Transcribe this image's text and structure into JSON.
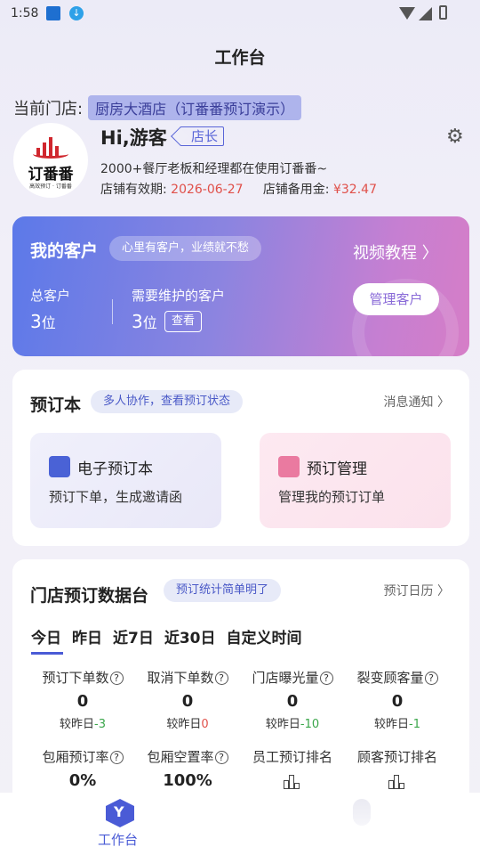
{
  "status_bar": {
    "time": "1:58"
  },
  "header": {
    "title": "工作台"
  },
  "store": {
    "label": "当前门店:",
    "name": "厨房大酒店（订番番预订演示）"
  },
  "profile": {
    "logo_brand": "订番番",
    "logo_sub": "高效预订 · 订番番",
    "greeting": "Hi,游客",
    "role": "店长",
    "description": "2000+餐厅老板和经理都在使用订番番~",
    "validity_label": "店铺有效期:",
    "validity_date": "2026-06-27",
    "reserve_label": "店铺备用金:",
    "reserve_amount": "¥32.47"
  },
  "customers": {
    "title": "我的客户",
    "slogan": "心里有客户，业绩就不愁",
    "video_link": "视频教程 〉",
    "total_label": "总客户",
    "total_value": "3",
    "total_unit": "位",
    "maintain_label": "需要维护的客户",
    "maintain_value": "3",
    "maintain_unit": "位",
    "view_button": "查看",
    "manage_button": "管理客户"
  },
  "booking": {
    "title": "预订本",
    "tag": "多人协作，查看预订状态",
    "link": "消息通知 〉",
    "tiles": [
      {
        "title": "电子预订本",
        "subtitle": "预订下单，生成邀请函"
      },
      {
        "title": "预订管理",
        "subtitle": "管理我的预订订单"
      }
    ]
  },
  "data_board": {
    "title": "门店预订数据台",
    "tag": "预订统计简单明了",
    "link": "预订日历 〉",
    "tabs": [
      "今日",
      "昨日",
      "近7日",
      "近30日",
      "自定义时间"
    ],
    "compare_prefix": "较昨日",
    "stats_row1": [
      {
        "label": "预订下单数",
        "value": "0",
        "delta": "-3",
        "delta_color": "green"
      },
      {
        "label": "取消下单数",
        "value": "0",
        "delta": "0",
        "delta_color": "red"
      },
      {
        "label": "门店曝光量",
        "value": "0",
        "delta": "-10",
        "delta_color": "green"
      },
      {
        "label": "裂变顾客量",
        "value": "0",
        "delta": "-1",
        "delta_color": "green"
      }
    ],
    "stats_row2": [
      {
        "label": "包厢预订率",
        "value": "0%"
      },
      {
        "label": "包厢空置率",
        "value": "100%"
      },
      {
        "label": "员工预订排名"
      },
      {
        "label": "顾客预订排名"
      }
    ]
  },
  "tabbar": {
    "active_label": "工作台"
  },
  "icons": {
    "settings": "gear-icon",
    "help": "question-circle-icon",
    "ranking": "bar-chart-icon",
    "workbench": "workbench-icon"
  }
}
